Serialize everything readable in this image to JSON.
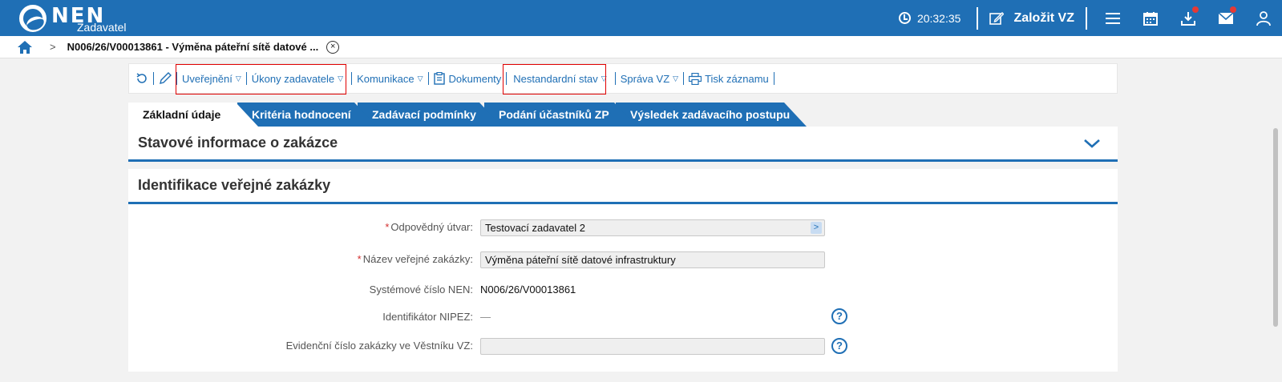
{
  "app": {
    "logo_text": "NEN",
    "logo_sub": "Zadavatel",
    "time": "20:32:35",
    "new_button": "Založit VZ"
  },
  "breadcrumb": {
    "title": "N006/26/V00013861 - Výměna páteřní sítě datové ...",
    "close": "×"
  },
  "toolbar": {
    "publishing": "Uveřejnění",
    "authority_actions": "Úkony zadavatele",
    "communication": "Komunikace",
    "documents": "Dokumenty",
    "nonstandard_state": "Nestandardní stav",
    "vz_management": "Správa VZ",
    "print_record": "Tisk záznamu"
  },
  "tabs": [
    {
      "label": "Základní údaje"
    },
    {
      "label": "Kritéria hodnocení"
    },
    {
      "label": "Zadávací podmínky"
    },
    {
      "label": "Podání účastníků ZP"
    },
    {
      "label": "Výsledek zadávacího postupu"
    }
  ],
  "sections": {
    "status_info": "Stavové informace o zakázce",
    "identification": "Identifikace veřejné zakázky"
  },
  "form": {
    "responsible_unit_label": "Odpovědný útvar:",
    "responsible_unit_value": "Testovací zadavatel 2",
    "contract_name_label": "Název veřejné zakázky:",
    "contract_name_value": "Výměna páteřní sítě datové infrastruktury",
    "system_number_label": "Systémové číslo NEN:",
    "system_number_value": "N006/26/V00013861",
    "nipez_label": "Identifikátor NIPEZ:",
    "nipez_value": "—",
    "journal_number_label": "Evidenční číslo zakázky ve Věstníku VZ:",
    "journal_number_value": "",
    "required_mark": "*",
    "help_mark": "?"
  },
  "colors": {
    "brand": "#1f6fb5",
    "required": "#d32f2f",
    "notification": "#e53935"
  }
}
